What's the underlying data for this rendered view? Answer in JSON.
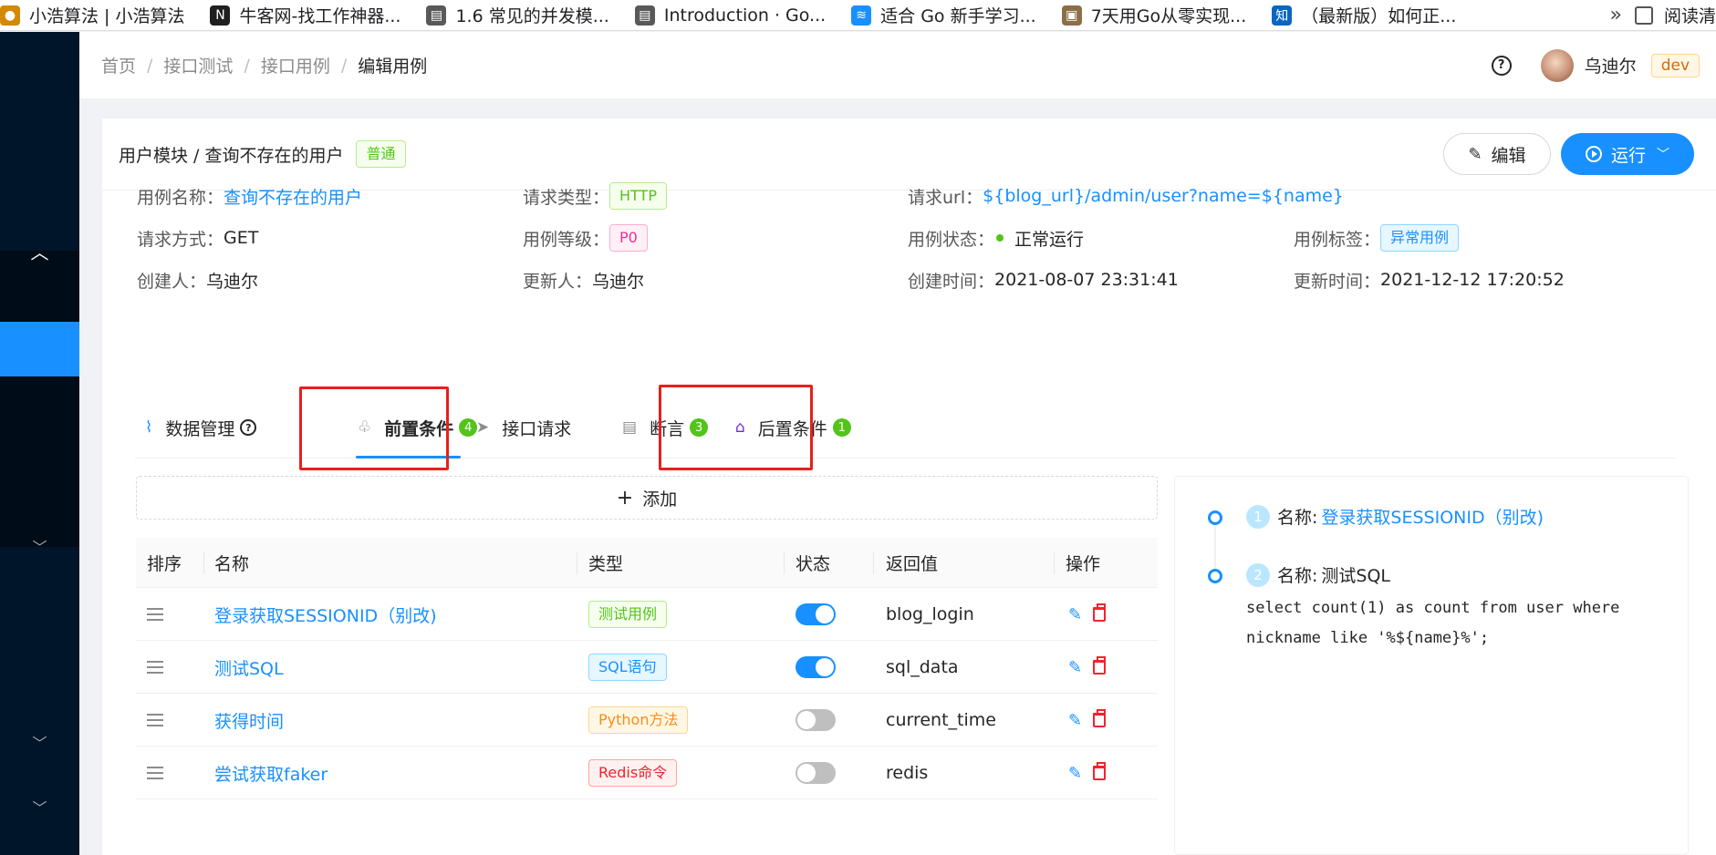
{
  "bookmarks": [
    {
      "title": "小浩算法 | 小浩算法",
      "color": "#d48806",
      "glyph": "●"
    },
    {
      "title": "牛客网-找工作神器...",
      "color": "#1f1f1f",
      "glyph": "N"
    },
    {
      "title": "1.6 常见的并发模...",
      "color": "#595959",
      "glyph": "▤"
    },
    {
      "title": "Introduction · Go...",
      "color": "#595959",
      "glyph": "▤"
    },
    {
      "title": "适合 Go 新手学习...",
      "color": "#1890ff",
      "glyph": "≋"
    },
    {
      "title": "7天用Go从零实现...",
      "color": "#8b6f47",
      "glyph": "▣"
    },
    {
      "title": "（最新版）如何正...",
      "color": "#0a66c2",
      "glyph": "知"
    }
  ],
  "bookmarks_more": "»",
  "reader_mode": "阅读清",
  "breadcrumb": [
    "首页",
    "接口测试",
    "接口用例",
    "编辑用例"
  ],
  "breadcrumb_sep": "/",
  "header": {
    "help": "?",
    "username": "乌迪尔",
    "env": "dev"
  },
  "case": {
    "title": "用户模块 / 查询不存在的用户",
    "level_tag": "普通",
    "edit_label": "编辑",
    "run_label": "运行"
  },
  "info": {
    "name_label": "用例名称：",
    "name_value": "查询不存在的用户",
    "req_type_label": "请求类型：",
    "req_type_value": "HTTP",
    "url_label": "请求url：",
    "url_value": "${blog_url}/admin/user?name=${name}",
    "method_label": "请求方式：",
    "method_value": "GET",
    "priority_label": "用例等级：",
    "priority_value": "P0",
    "status_label": "用例状态：",
    "status_value": "正常运行",
    "tag_label": "用例标签：",
    "tag_value": "异常用例",
    "creator_label": "创建人：",
    "creator_value": "乌迪尔",
    "updater_label": "更新人：",
    "updater_value": "乌迪尔",
    "created_label": "创建时间：",
    "created_value": "2021-08-07 23:31:41",
    "updated_label": "更新时间：",
    "updated_value": "2021-12-12 17:20:52"
  },
  "tabs": [
    {
      "label": "数据管理",
      "badge": ""
    },
    {
      "label": "前置条件",
      "badge": "4"
    },
    {
      "label": "接口请求",
      "badge": ""
    },
    {
      "label": "断言",
      "badge": "3"
    },
    {
      "label": "后置条件",
      "badge": "1"
    }
  ],
  "add_label": "添加",
  "table": {
    "columns": [
      "排序",
      "名称",
      "类型",
      "状态",
      "返回值",
      "操作"
    ],
    "rows": [
      {
        "name": "登录获取SESSIONID（别改)",
        "type": "测试用例",
        "type_color": "green",
        "enabled": true,
        "return": "blog_login"
      },
      {
        "name": "测试SQL",
        "type": "SQL语句",
        "type_color": "blue",
        "enabled": true,
        "return": "sql_data"
      },
      {
        "name": "获得时间",
        "type": "Python方法",
        "type_color": "orange",
        "enabled": false,
        "return": "current_time"
      },
      {
        "name": "尝试获取faker",
        "type": "Redis命令",
        "type_color": "red",
        "enabled": false,
        "return": "redis"
      }
    ]
  },
  "timeline": [
    {
      "num": "1",
      "label": "名称:",
      "name": "登录获取SESSIONID（别改)",
      "sql": ""
    },
    {
      "num": "2",
      "label": "名称:",
      "name": "测试SQL",
      "sql": "select count(1) as count from user where\nnickname like '%${name}%';"
    }
  ],
  "colors": {
    "primary": "#1890ff",
    "sidebar": "#001529",
    "highlight_box": "#e5211d"
  }
}
